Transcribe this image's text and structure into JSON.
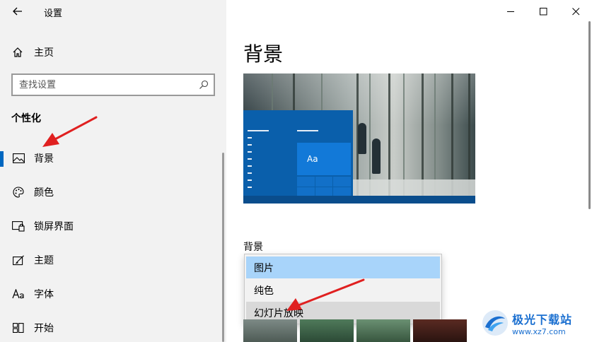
{
  "window": {
    "title": "设置"
  },
  "sidebar": {
    "home_label": "主页",
    "search_placeholder": "查找设置",
    "section_title": "个性化",
    "items": [
      {
        "label": "背景",
        "icon": "picture-icon",
        "selected": true
      },
      {
        "label": "颜色",
        "icon": "palette-icon",
        "selected": false
      },
      {
        "label": "锁屏界面",
        "icon": "lock-screen-icon",
        "selected": false
      },
      {
        "label": "主题",
        "icon": "theme-icon",
        "selected": false
      },
      {
        "label": "字体",
        "icon": "font-icon",
        "selected": false
      },
      {
        "label": "开始",
        "icon": "start-icon",
        "selected": false
      }
    ]
  },
  "main": {
    "page_title": "背景",
    "preview_tile_text": "Aa",
    "background_label": "背景",
    "dropdown": {
      "options": [
        "图片",
        "纯色",
        "幻灯片放映"
      ],
      "selected": "图片",
      "hovered": "幻灯片放映"
    }
  },
  "colors": {
    "accent": "#0067c0",
    "selected_option": "#a8d4fa",
    "annotation_arrow": "#e02020"
  },
  "watermark": {
    "name": "极光下载站",
    "url": "www.xz7.com"
  }
}
